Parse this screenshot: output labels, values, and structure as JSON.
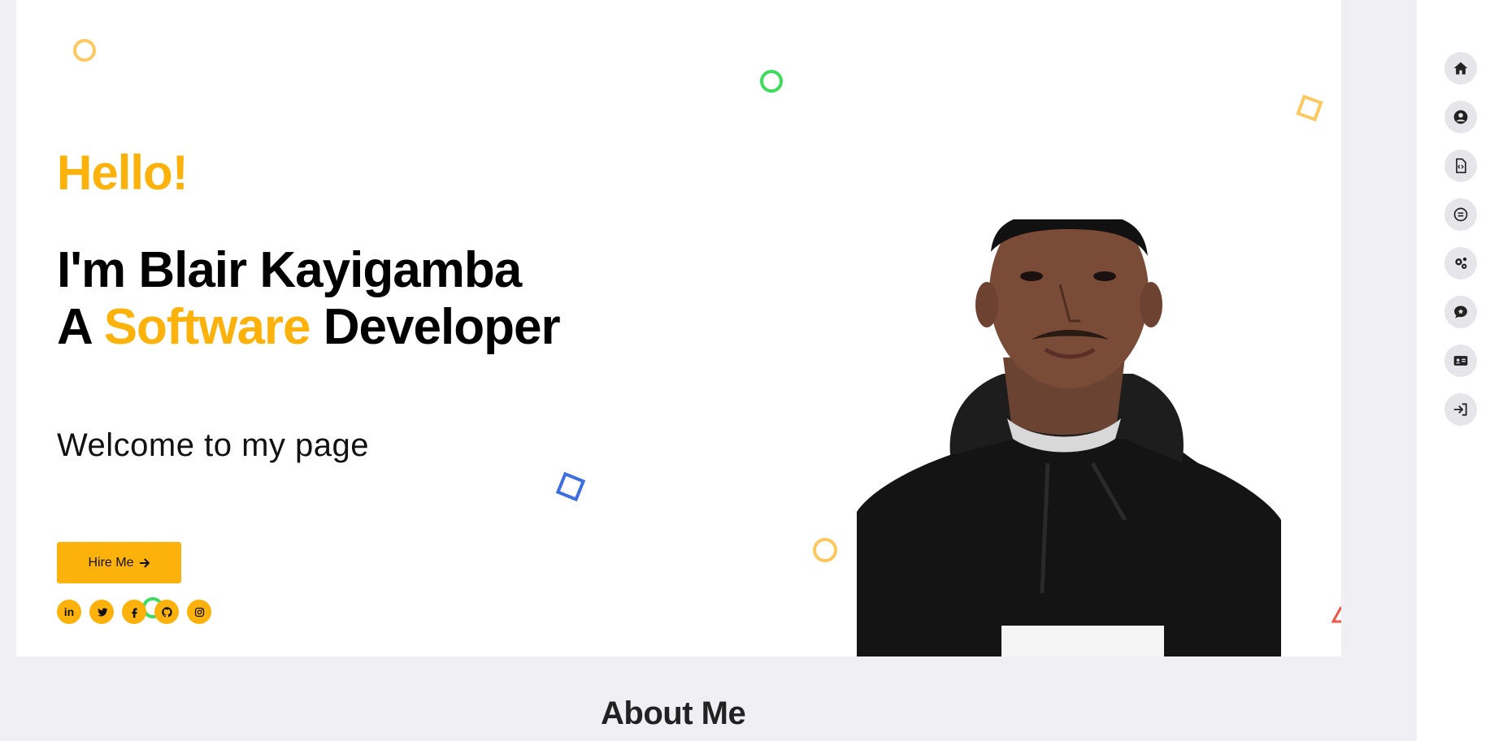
{
  "hero": {
    "greeting": "Hello!",
    "name_line": "I'm Blair Kayigamba",
    "role_prefix": "A ",
    "role_accent": "Software",
    "role_suffix": " Developer",
    "welcome": "Welcome to my page",
    "hire_button": "Hire Me",
    "socials": [
      {
        "icon": "linkedin-icon",
        "label": "in"
      },
      {
        "icon": "twitter-icon"
      },
      {
        "icon": "facebook-icon"
      },
      {
        "icon": "github-icon"
      },
      {
        "icon": "instagram-icon"
      }
    ]
  },
  "about": {
    "title": "About Me"
  },
  "sidenav": {
    "items": [
      {
        "icon": "home-icon"
      },
      {
        "icon": "user-icon"
      },
      {
        "icon": "file-code-icon"
      },
      {
        "icon": "list-icon"
      },
      {
        "icon": "gears-icon"
      },
      {
        "icon": "star-comment-icon"
      },
      {
        "icon": "id-card-icon"
      },
      {
        "icon": "sign-in-icon"
      }
    ]
  },
  "colors": {
    "accent": "#fdb20b",
    "background": "#efeff4",
    "card": "#ffffff",
    "nav_button": "#e6e6ea",
    "shape_green": "#3ddc5a",
    "shape_blue": "#3d6fe0",
    "shape_red": "#f05545"
  }
}
